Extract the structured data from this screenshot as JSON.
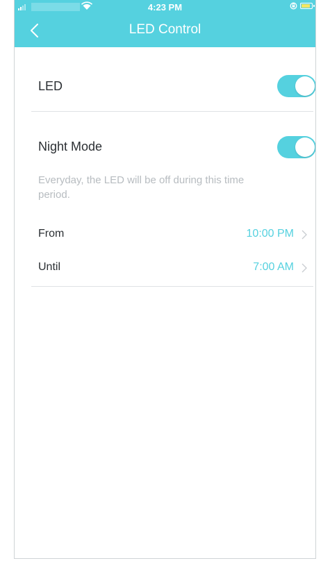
{
  "status": {
    "time": "4:23 PM"
  },
  "header": {
    "title": "LED Control",
    "background_color": "#55d1df"
  },
  "led": {
    "label": "LED",
    "enabled": true
  },
  "night_mode": {
    "label": "Night Mode",
    "enabled": true,
    "description": "Everyday, the LED will be off during this time period.",
    "from": {
      "label": "From",
      "value": "10:00 PM"
    },
    "until": {
      "label": "Until",
      "value": "7:00 AM"
    }
  },
  "colors": {
    "accent": "#55d1df",
    "text": "#2b2f33",
    "hint": "#b7bcc0",
    "divider": "#dfe2e4"
  }
}
